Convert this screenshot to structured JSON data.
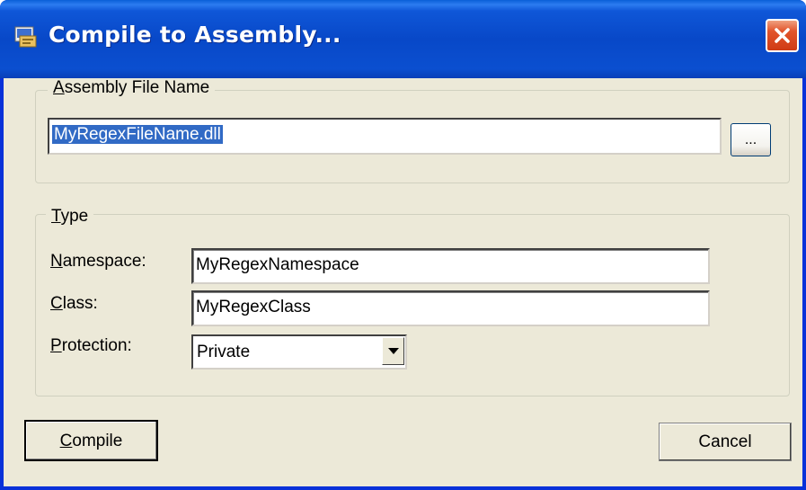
{
  "window": {
    "title": "Compile to Assembly..."
  },
  "assembly_group": {
    "title_prefix": "",
    "title_accesskey": "A",
    "title_rest": "ssembly File Name",
    "file_name_value": "MyRegexFileName.dll",
    "browse_label": "..."
  },
  "type_group": {
    "title_accesskey": "T",
    "title_rest": "ype",
    "namespace_label_key": "N",
    "namespace_label_rest": "amespace:",
    "namespace_value": "MyRegexNamespace",
    "class_label_key": "C",
    "class_label_rest": "lass:",
    "class_value": "MyRegexClass",
    "protection_label_key": "P",
    "protection_label_rest": "rotection:",
    "protection_selected": "Private"
  },
  "buttons": {
    "compile_key": "C",
    "compile_rest": "ompile",
    "cancel_label": "Cancel"
  },
  "colors": {
    "titlebar": "#0848c8",
    "dialog_bg": "#ece9d8",
    "selection": "#316ac5",
    "close_button": "#e2552c"
  },
  "icons": {
    "app": "compile-app-icon",
    "close": "close-icon",
    "dropdown": "chevron-down-icon"
  }
}
